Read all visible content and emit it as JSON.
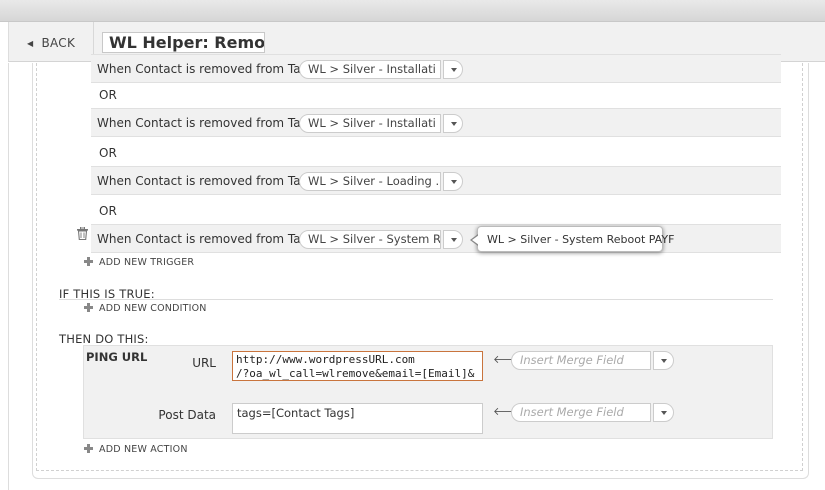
{
  "header": {
    "back_label": "BACK",
    "title_value": "WL Helper: Remove"
  },
  "triggers": [
    {
      "label": "When Contact is removed from Tag:",
      "tag": "WL > Silver - Installati ..."
    },
    {
      "label": "When Contact is removed from Tag:",
      "tag": "WL > Silver - Installati ..."
    },
    {
      "label": "When Contact is removed from Tag:",
      "tag": "WL > Silver - Loading ..."
    },
    {
      "label": "When Contact is removed from Tag:",
      "tag": "WL > Silver - System R..."
    }
  ],
  "or_label": "OR",
  "tooltip_text": "WL > Silver - System Reboot PAYF",
  "add_trigger_label": "ADD NEW TRIGGER",
  "condition_heading": "IF THIS IS TRUE:",
  "add_condition_label": "ADD NEW CONDITION",
  "action_heading": "THEN DO THIS:",
  "action": {
    "type_label": "PING URL",
    "url_label": "URL",
    "url_value": "http://www.wordpressURL.com\n/?oa_wl_call=wlremove&email=[Email]&",
    "post_label": "Post Data",
    "post_value": "tags=[Contact Tags]",
    "merge_placeholder": "Insert Merge Field"
  },
  "add_action_label": "ADD NEW ACTION"
}
